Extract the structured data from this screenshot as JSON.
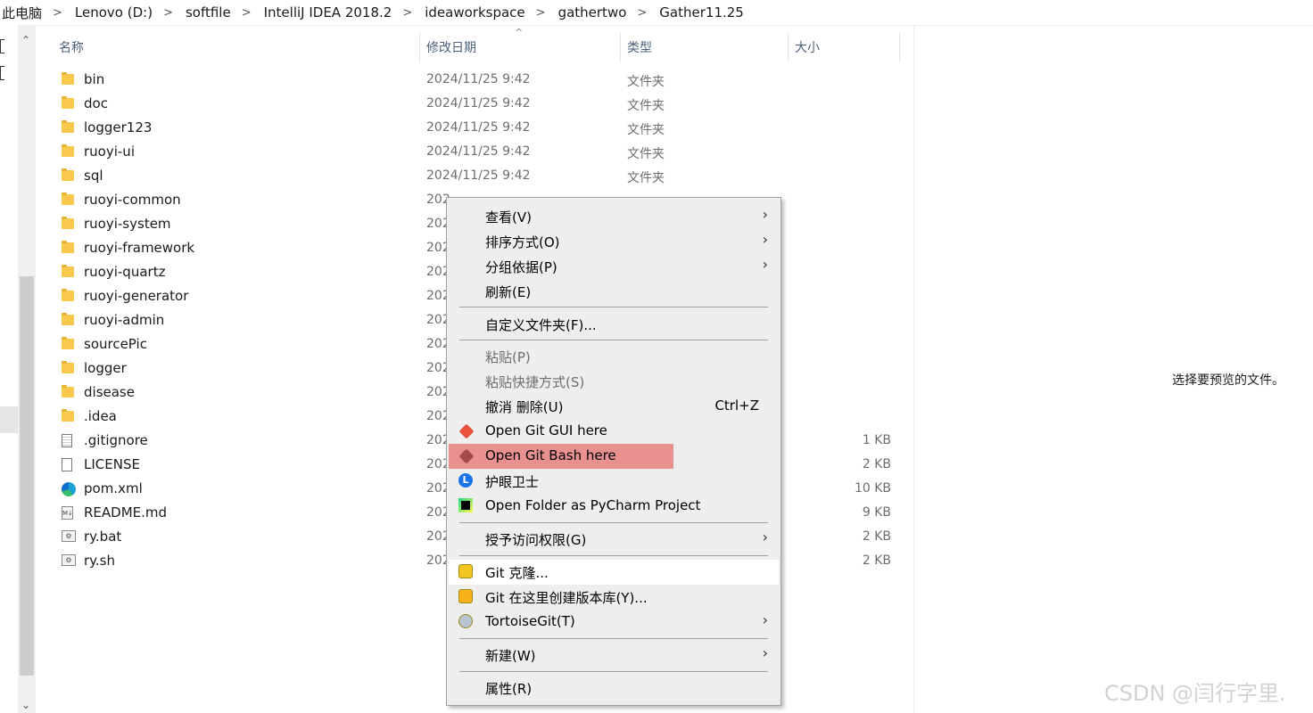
{
  "breadcrumb": [
    "此电脑",
    "Lenovo (D:)",
    "softfile",
    "IntelliJ IDEA 2018.2",
    "ideaworkspace",
    "gathertwo",
    "Gather11.25"
  ],
  "columns": {
    "name": "名称",
    "date": "修改日期",
    "type": "类型",
    "size": "大小"
  },
  "files": [
    {
      "name": "bin",
      "date": "2024/11/25 9:42",
      "type": "文件夹",
      "size": "",
      "icon": "folder-icon"
    },
    {
      "name": "doc",
      "date": "2024/11/25 9:42",
      "type": "文件夹",
      "size": "",
      "icon": "folder-icon"
    },
    {
      "name": "logger123",
      "date": "2024/11/25 9:42",
      "type": "文件夹",
      "size": "",
      "icon": "folder-icon"
    },
    {
      "name": "ruoyi-ui",
      "date": "2024/11/25 9:42",
      "type": "文件夹",
      "size": "",
      "icon": "folder-icon"
    },
    {
      "name": "sql",
      "date": "2024/11/25 9:42",
      "type": "文件夹",
      "size": "",
      "icon": "folder-icon"
    },
    {
      "name": "ruoyi-common",
      "date": "202",
      "type": "",
      "size": "",
      "icon": "folder-icon"
    },
    {
      "name": "ruoyi-system",
      "date": "202",
      "type": "",
      "size": "",
      "icon": "folder-icon"
    },
    {
      "name": "ruoyi-framework",
      "date": "202",
      "type": "",
      "size": "",
      "icon": "folder-icon"
    },
    {
      "name": "ruoyi-quartz",
      "date": "202",
      "type": "",
      "size": "",
      "icon": "folder-icon"
    },
    {
      "name": "ruoyi-generator",
      "date": "202",
      "type": "",
      "size": "",
      "icon": "folder-icon"
    },
    {
      "name": "ruoyi-admin",
      "date": "202",
      "type": "",
      "size": "",
      "icon": "folder-icon"
    },
    {
      "name": "sourcePic",
      "date": "202",
      "type": "",
      "size": "",
      "icon": "folder-icon"
    },
    {
      "name": "logger",
      "date": "202",
      "type": "",
      "size": "",
      "icon": "folder-icon"
    },
    {
      "name": "disease",
      "date": "202",
      "type": "",
      "size": "",
      "icon": "folder-icon"
    },
    {
      "name": ".idea",
      "date": "202",
      "type": "",
      "size": "",
      "icon": "folder-icon"
    },
    {
      "name": ".gitignore",
      "date": "202",
      "type": "",
      "size": "1 KB",
      "icon": "text-file-icon"
    },
    {
      "name": "LICENSE",
      "date": "202",
      "type": "",
      "size": "2 KB",
      "icon": "file-icon"
    },
    {
      "name": "pom.xml",
      "date": "202",
      "type": "",
      "size": "10 KB",
      "icon": "edge-file-icon"
    },
    {
      "name": "README.md",
      "date": "202",
      "type": "",
      "size": "9 KB",
      "icon": "markdown-file-icon"
    },
    {
      "name": "ry.bat",
      "date": "202",
      "type": "",
      "size": "2 KB",
      "icon": "batch-file-icon"
    },
    {
      "name": "ry.sh",
      "date": "202",
      "type": "",
      "size": "2 KB",
      "icon": "batch-file-icon"
    }
  ],
  "preview": {
    "message": "选择要预览的文件。"
  },
  "watermark": "CSDN @闫行字里.",
  "context_menu": {
    "view": "查看(V)",
    "sort": "排序方式(O)",
    "group": "分组依据(P)",
    "refresh": "刷新(E)",
    "customize": "自定义文件夹(F)...",
    "paste": "粘贴(P)",
    "paste_shortcut": "粘贴快捷方式(S)",
    "undo": "撤消 删除(U)",
    "undo_shortcut": "Ctrl+Z",
    "git_gui": "Open Git GUI here",
    "git_bash": "Open Git Bash here",
    "eye_guard": "护眼卫士",
    "pycharm": "Open Folder as PyCharm Project",
    "access": "授予访问权限(G)",
    "git_clone": "Git 克隆...",
    "git_create": "Git 在这里创建版本库(Y)...",
    "tortoise": "TortoiseGit(T)",
    "new": "新建(W)",
    "properties": "属性(R)"
  },
  "colors": {
    "highlight": "#e99090",
    "menu_bg": "#eeeeee",
    "header_text": "#4c607a"
  }
}
